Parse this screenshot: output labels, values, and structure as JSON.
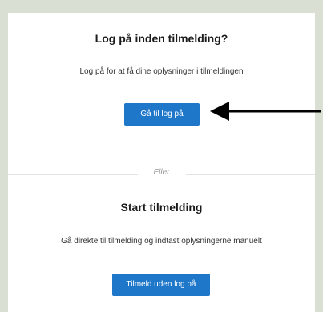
{
  "login_section": {
    "title": "Log på inden tilmelding?",
    "subtitle": "Log på for at få dine oplysninger i tilmeldingen",
    "button_label": "Gå til log på"
  },
  "divider": {
    "label": "Eller"
  },
  "start_section": {
    "title": "Start tilmelding",
    "subtitle": "Gå direkte til tilmelding og indtast oplysningerne manuelt",
    "button_label": "Tilmeld uden log på"
  },
  "colors": {
    "background": "#d9e0d3",
    "card": "#ffffff",
    "primary_button": "#1f77c9",
    "arrow": "#000000"
  },
  "icons": {
    "annotation_arrow": "left-arrow-icon"
  }
}
